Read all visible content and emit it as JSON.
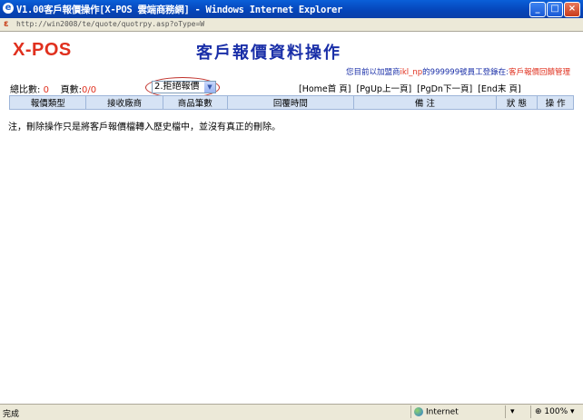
{
  "window": {
    "title": "V1.00客戶報價操作[X-POS 雲端商務網] - Windows Internet Explorer",
    "minimize": "_",
    "maximize": "□",
    "close": "×"
  },
  "address": {
    "url": "http://win2008/te/quote/quotrpy.asp?oType=W"
  },
  "header": {
    "logo": "X-POS",
    "title": "客戶報價資料操作"
  },
  "user": {
    "prefix": "您目前以加盟商",
    "account": "ikl_np",
    "middle": "的999999號員工登錄在:",
    "module": "客戶報價回饋管理"
  },
  "summary": {
    "total_label": "總比數:",
    "total_value": "0",
    "pages_label": "頁數:",
    "pages_value": "0/0"
  },
  "filter": {
    "selected": "2.拒絕報價"
  },
  "pager": {
    "first": "[Home首 頁]",
    "prev": "[PgUp上一頁]",
    "next": "[PgDn下一頁]",
    "last": "[End末 頁]"
  },
  "table": {
    "columns": [
      "報價類型",
      "接收廠商",
      "商品筆數",
      "回覆時間",
      "備 注",
      "狀 態",
      "操 作"
    ]
  },
  "note": "注，刪除操作只是將客戶報價檔轉入歷史檔中，並沒有真正的刪除。",
  "status": {
    "text": "完成",
    "zone": "Internet",
    "zoom": "100%"
  }
}
